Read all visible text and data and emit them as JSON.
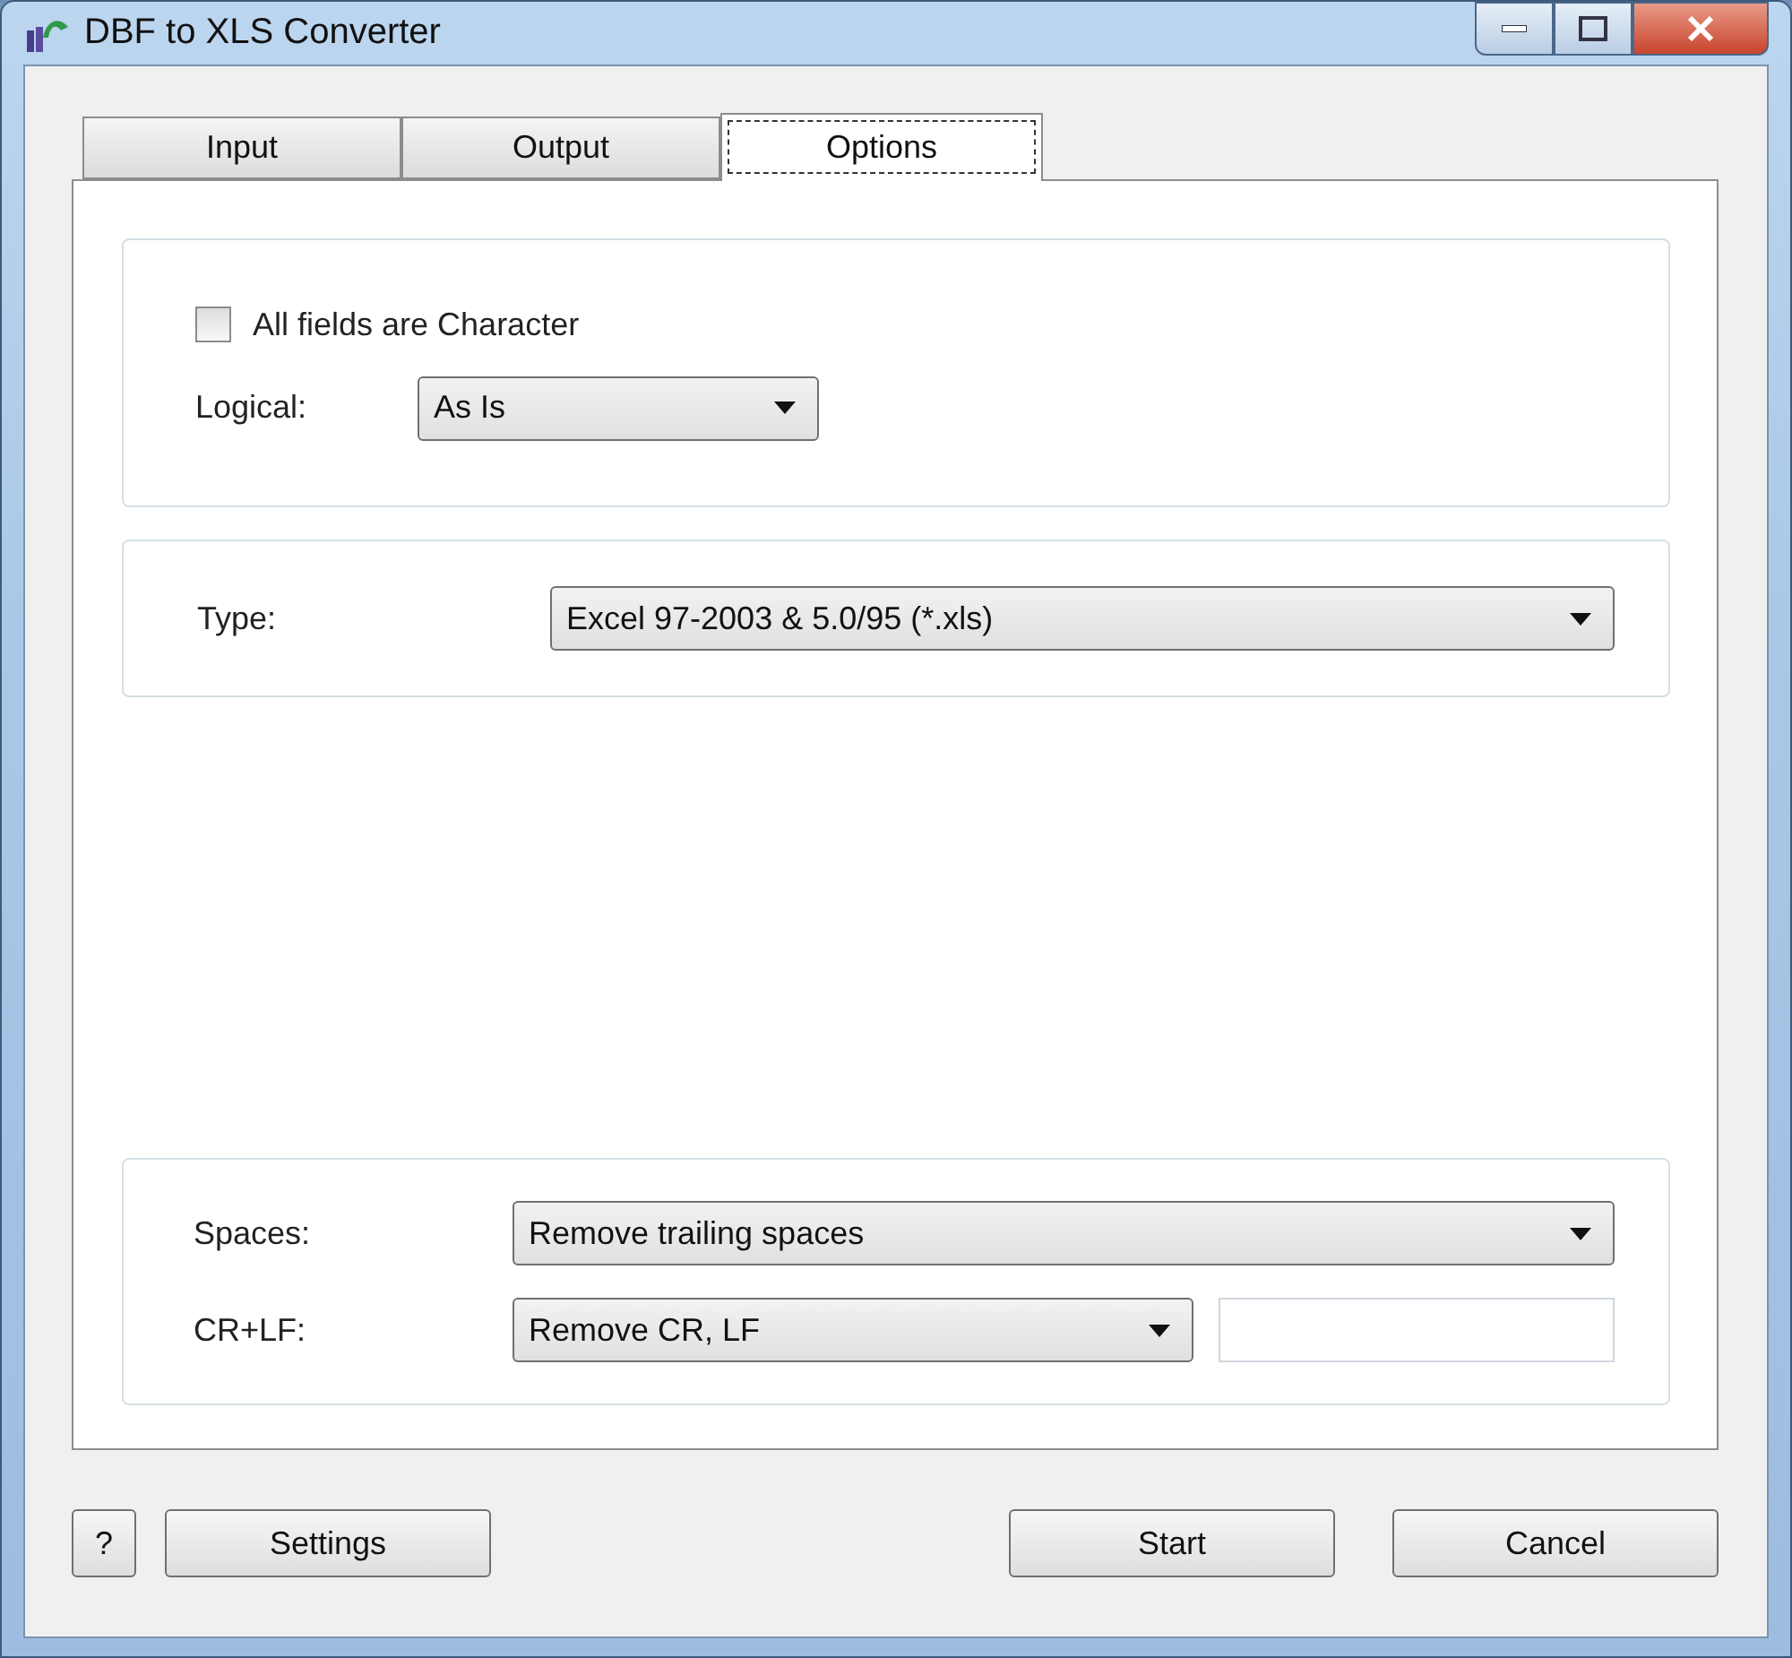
{
  "window": {
    "title": "DBF to XLS Converter"
  },
  "tabs": [
    {
      "label": "Input",
      "selected": false
    },
    {
      "label": "Output",
      "selected": false
    },
    {
      "label": "Options",
      "selected": true
    }
  ],
  "all_fields_character": {
    "label": "All fields are Character",
    "checked": false
  },
  "logical": {
    "label": "Logical:",
    "value": "As Is"
  },
  "type": {
    "label": "Type:",
    "value": "Excel 97-2003 & 5.0/95 (*.xls)"
  },
  "spaces": {
    "label": "Spaces:",
    "value": "Remove trailing spaces"
  },
  "crlf": {
    "label": "CR+LF:",
    "value": "Remove CR, LF"
  },
  "buttons": {
    "help": "?",
    "settings": "Settings",
    "start": "Start",
    "cancel": "Cancel"
  }
}
